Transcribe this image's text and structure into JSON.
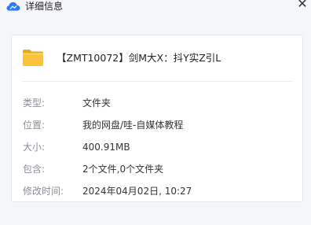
{
  "window": {
    "title": "详细信息",
    "close_glyph": "✕"
  },
  "icons": {
    "app": "cloud-icon",
    "file": "folder-icon",
    "close": "close-icon"
  },
  "colors": {
    "cloud_blue": "#2a7cf6",
    "folder_yellow": "#f8c33a",
    "label_gray": "#8b8e98"
  },
  "file": {
    "name": "【ZMT10072】剑M大X：抖Y实Z引L"
  },
  "details": [
    {
      "label": "类型:",
      "value": "文件夹"
    },
    {
      "label": "位置:",
      "value": "我的网盘/哇-自媒体教程"
    },
    {
      "label": "大小:",
      "value": "400.91MB"
    },
    {
      "label": "包含:",
      "value": "2个文件,0个文件夹"
    },
    {
      "label": "修改时间:",
      "value": "2024年04月02日, 10:27"
    }
  ]
}
